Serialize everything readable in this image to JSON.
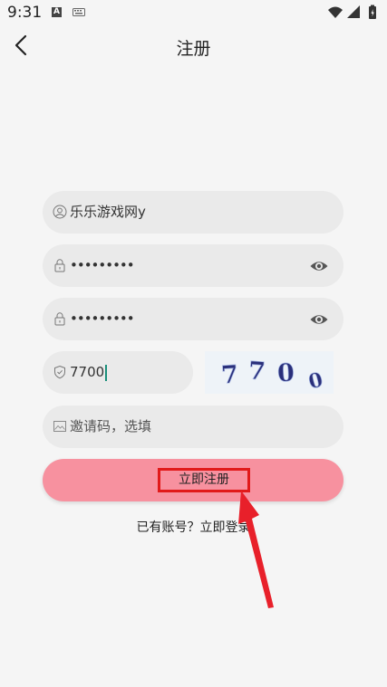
{
  "status_bar": {
    "time": "9:31",
    "notif_letter": "A"
  },
  "header": {
    "title": "注册",
    "back_icon": "chevron-left-icon"
  },
  "form": {
    "username": {
      "value": "乐乐游戏网y",
      "icon": "user-icon"
    },
    "password": {
      "value": "•••••••••",
      "icon": "lock-icon",
      "toggle_icon": "eye-icon"
    },
    "confirm_password": {
      "value": "•••••••••",
      "icon": "lock-icon",
      "toggle_icon": "eye-icon"
    },
    "captcha_input": {
      "value": "7700",
      "icon": "shield-icon"
    },
    "captcha_image_text": "7700",
    "invite_code": {
      "placeholder": "邀请码，选填",
      "icon": "image-icon"
    },
    "submit_label": "立即注册"
  },
  "footer": {
    "login_prompt": "已有账号？立即登录"
  },
  "colors": {
    "background": "#f5f5f5",
    "field_bg": "#eaeaea",
    "button_bg": "#f7919f",
    "highlight_red": "#e11a1a",
    "captcha_ink": "#2a2f7a"
  }
}
